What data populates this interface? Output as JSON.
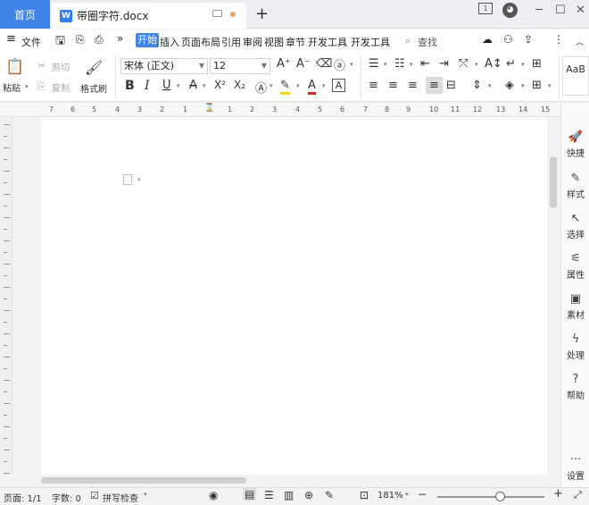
{
  "titlebar": {
    "home_tab": "首页",
    "doc_tab_name": "带圈字符.docx",
    "new_tab": "+",
    "win_buttons": [
      "─",
      "☐",
      "✕"
    ]
  },
  "menubar": {
    "file": "文件",
    "more": "»",
    "tabs": [
      "开始",
      "插入",
      "页面布局",
      "引用",
      "审阅",
      "视图",
      "章节",
      "开发工具",
      "开发工具"
    ],
    "active_tab": "开始",
    "search": "查找",
    "more_menu": "⋮"
  },
  "toolbar": {
    "paste": "粘贴",
    "cut": "剪切",
    "copy": "复制",
    "format_painter": "格式刷",
    "font_name": "宋体 (正文)",
    "font_size": "12",
    "styles_sample": "AaB"
  },
  "ruler": {
    "numbers": [
      "7",
      "6",
      "5",
      "4",
      "3",
      "2",
      "1",
      "1",
      "2",
      "3",
      "4",
      "5",
      "6",
      "7",
      "8",
      "9",
      "10",
      "11",
      "12",
      "13",
      "14",
      "15"
    ]
  },
  "sidepanel": {
    "items": [
      "快捷",
      "样式",
      "选择",
      "属性",
      "素材",
      "处理",
      "帮助"
    ],
    "settings": "设置"
  },
  "statusbar": {
    "page": "页面: 1/1",
    "wordcount": "字数: 0",
    "spellcheck": "拼写检查",
    "zoom": "181%",
    "zoom_minus": "−",
    "zoom_plus": "+"
  }
}
